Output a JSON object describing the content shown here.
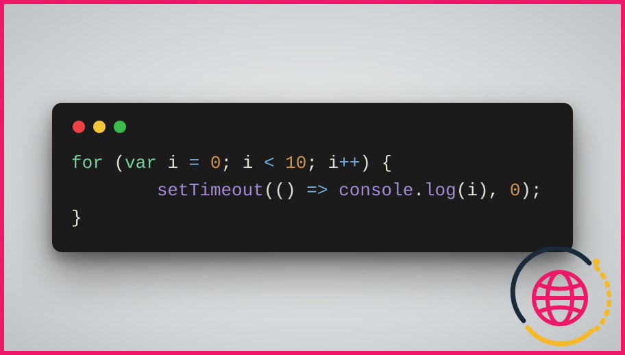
{
  "syntax": {
    "keywords": {
      "for": "for",
      "var": "var"
    },
    "identifiers": {
      "i": "i",
      "console": "console"
    },
    "operators": {
      "assign": "=",
      "lt": "<",
      "inc": "++",
      "arrow": "=>"
    },
    "numbers": {
      "zero": "0",
      "ten": "10",
      "zero2": "0"
    },
    "punct": {
      "lparen": "(",
      "rparen": ")",
      "lbrace": "{",
      "rbrace": "}",
      "semi": ";",
      "comma": ",",
      "dot": "."
    },
    "functions": {
      "setTimeout": "setTimeout",
      "log": "log"
    }
  },
  "indent": "        ",
  "colors": {
    "border": "#ed1868",
    "window_bg": "#1b1b1b",
    "traffic_red": "#ed4343",
    "traffic_yellow": "#f3c63a",
    "traffic_green": "#3abb4c",
    "keyword": "#7bcf9b",
    "operator": "#6fb0e3",
    "number": "#d2924f",
    "function": "#a48ad4",
    "default": "#e2e2d6"
  },
  "logo": {
    "arc_dark": "#1b2a3a",
    "arc_yellow": "#f3b92b",
    "globe": "#ed1868",
    "dot": "#f3b92b"
  }
}
